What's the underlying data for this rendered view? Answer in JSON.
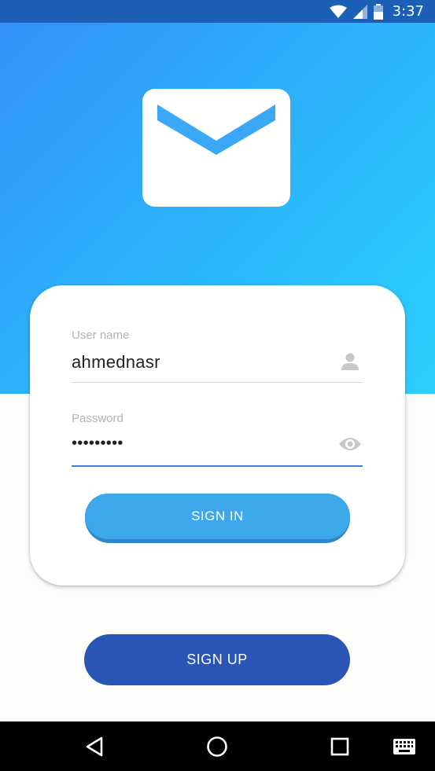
{
  "status_bar": {
    "time": "3:37",
    "icons": [
      "wifi-icon",
      "cellular-signal-icon",
      "battery-icon"
    ]
  },
  "hero": {
    "logo_icon": "envelope-icon",
    "gradient_start": "#3391f8",
    "gradient_end": "#2bd0ff"
  },
  "login_form": {
    "username": {
      "label": "User name",
      "value": "ahmednasr",
      "icon": "person-icon"
    },
    "password": {
      "label": "Password",
      "value": "•••••••••",
      "icon": "eye-icon"
    },
    "signin_label": "SIGN IN"
  },
  "signup_label": "SIGN UP",
  "nav_bar": {
    "buttons": [
      "back-icon",
      "home-icon",
      "recents-icon",
      "keyboard-icon"
    ]
  },
  "colors": {
    "accent": "#3da8e9",
    "signup": "#2a55b7",
    "status_bar": "#1b5fb7",
    "input_underline_active": "#3a7ee3"
  }
}
